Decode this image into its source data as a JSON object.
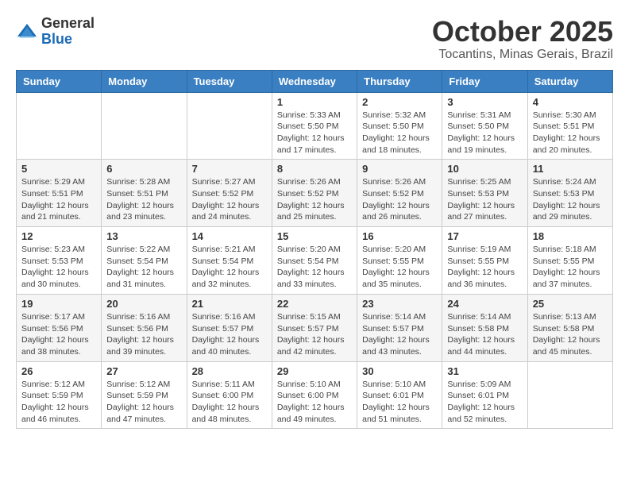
{
  "logo": {
    "general": "General",
    "blue": "Blue"
  },
  "header": {
    "month": "October 2025",
    "location": "Tocantins, Minas Gerais, Brazil"
  },
  "days_of_week": [
    "Sunday",
    "Monday",
    "Tuesday",
    "Wednesday",
    "Thursday",
    "Friday",
    "Saturday"
  ],
  "weeks": [
    [
      {
        "day": "",
        "info": ""
      },
      {
        "day": "",
        "info": ""
      },
      {
        "day": "",
        "info": ""
      },
      {
        "day": "1",
        "info": "Sunrise: 5:33 AM\nSunset: 5:50 PM\nDaylight: 12 hours\nand 17 minutes."
      },
      {
        "day": "2",
        "info": "Sunrise: 5:32 AM\nSunset: 5:50 PM\nDaylight: 12 hours\nand 18 minutes."
      },
      {
        "day": "3",
        "info": "Sunrise: 5:31 AM\nSunset: 5:50 PM\nDaylight: 12 hours\nand 19 minutes."
      },
      {
        "day": "4",
        "info": "Sunrise: 5:30 AM\nSunset: 5:51 PM\nDaylight: 12 hours\nand 20 minutes."
      }
    ],
    [
      {
        "day": "5",
        "info": "Sunrise: 5:29 AM\nSunset: 5:51 PM\nDaylight: 12 hours\nand 21 minutes."
      },
      {
        "day": "6",
        "info": "Sunrise: 5:28 AM\nSunset: 5:51 PM\nDaylight: 12 hours\nand 23 minutes."
      },
      {
        "day": "7",
        "info": "Sunrise: 5:27 AM\nSunset: 5:52 PM\nDaylight: 12 hours\nand 24 minutes."
      },
      {
        "day": "8",
        "info": "Sunrise: 5:26 AM\nSunset: 5:52 PM\nDaylight: 12 hours\nand 25 minutes."
      },
      {
        "day": "9",
        "info": "Sunrise: 5:26 AM\nSunset: 5:52 PM\nDaylight: 12 hours\nand 26 minutes."
      },
      {
        "day": "10",
        "info": "Sunrise: 5:25 AM\nSunset: 5:53 PM\nDaylight: 12 hours\nand 27 minutes."
      },
      {
        "day": "11",
        "info": "Sunrise: 5:24 AM\nSunset: 5:53 PM\nDaylight: 12 hours\nand 29 minutes."
      }
    ],
    [
      {
        "day": "12",
        "info": "Sunrise: 5:23 AM\nSunset: 5:53 PM\nDaylight: 12 hours\nand 30 minutes."
      },
      {
        "day": "13",
        "info": "Sunrise: 5:22 AM\nSunset: 5:54 PM\nDaylight: 12 hours\nand 31 minutes."
      },
      {
        "day": "14",
        "info": "Sunrise: 5:21 AM\nSunset: 5:54 PM\nDaylight: 12 hours\nand 32 minutes."
      },
      {
        "day": "15",
        "info": "Sunrise: 5:20 AM\nSunset: 5:54 PM\nDaylight: 12 hours\nand 33 minutes."
      },
      {
        "day": "16",
        "info": "Sunrise: 5:20 AM\nSunset: 5:55 PM\nDaylight: 12 hours\nand 35 minutes."
      },
      {
        "day": "17",
        "info": "Sunrise: 5:19 AM\nSunset: 5:55 PM\nDaylight: 12 hours\nand 36 minutes."
      },
      {
        "day": "18",
        "info": "Sunrise: 5:18 AM\nSunset: 5:55 PM\nDaylight: 12 hours\nand 37 minutes."
      }
    ],
    [
      {
        "day": "19",
        "info": "Sunrise: 5:17 AM\nSunset: 5:56 PM\nDaylight: 12 hours\nand 38 minutes."
      },
      {
        "day": "20",
        "info": "Sunrise: 5:16 AM\nSunset: 5:56 PM\nDaylight: 12 hours\nand 39 minutes."
      },
      {
        "day": "21",
        "info": "Sunrise: 5:16 AM\nSunset: 5:57 PM\nDaylight: 12 hours\nand 40 minutes."
      },
      {
        "day": "22",
        "info": "Sunrise: 5:15 AM\nSunset: 5:57 PM\nDaylight: 12 hours\nand 42 minutes."
      },
      {
        "day": "23",
        "info": "Sunrise: 5:14 AM\nSunset: 5:57 PM\nDaylight: 12 hours\nand 43 minutes."
      },
      {
        "day": "24",
        "info": "Sunrise: 5:14 AM\nSunset: 5:58 PM\nDaylight: 12 hours\nand 44 minutes."
      },
      {
        "day": "25",
        "info": "Sunrise: 5:13 AM\nSunset: 5:58 PM\nDaylight: 12 hours\nand 45 minutes."
      }
    ],
    [
      {
        "day": "26",
        "info": "Sunrise: 5:12 AM\nSunset: 5:59 PM\nDaylight: 12 hours\nand 46 minutes."
      },
      {
        "day": "27",
        "info": "Sunrise: 5:12 AM\nSunset: 5:59 PM\nDaylight: 12 hours\nand 47 minutes."
      },
      {
        "day": "28",
        "info": "Sunrise: 5:11 AM\nSunset: 6:00 PM\nDaylight: 12 hours\nand 48 minutes."
      },
      {
        "day": "29",
        "info": "Sunrise: 5:10 AM\nSunset: 6:00 PM\nDaylight: 12 hours\nand 49 minutes."
      },
      {
        "day": "30",
        "info": "Sunrise: 5:10 AM\nSunset: 6:01 PM\nDaylight: 12 hours\nand 51 minutes."
      },
      {
        "day": "31",
        "info": "Sunrise: 5:09 AM\nSunset: 6:01 PM\nDaylight: 12 hours\nand 52 minutes."
      },
      {
        "day": "",
        "info": ""
      }
    ]
  ]
}
